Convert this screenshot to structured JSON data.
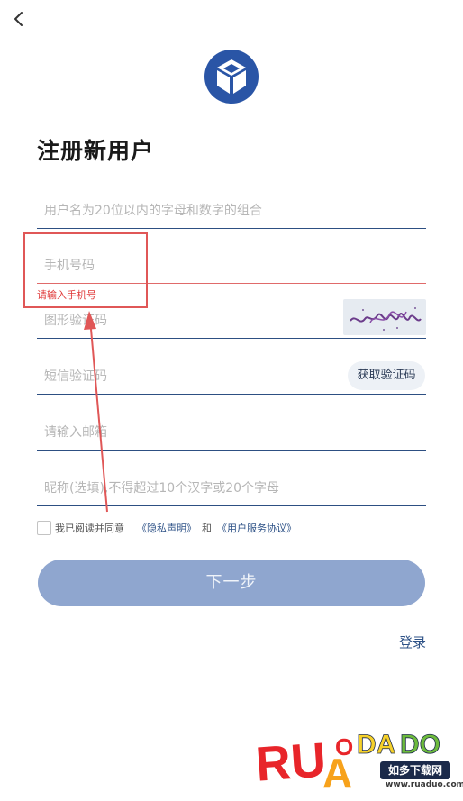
{
  "header": {
    "back_icon": "chevron-left-icon",
    "logo_icon": "cube-logo-icon"
  },
  "page": {
    "title": "注册新用户"
  },
  "form": {
    "username_placeholder": "用户名为20位以内的字母和数字的组合",
    "phone_placeholder": "手机号码",
    "phone_error": "请输入手机号",
    "captcha_placeholder": "图形验证码",
    "sms_placeholder": "短信验证码",
    "sms_button_label": "获取验证码",
    "email_placeholder": "请输入邮箱",
    "nickname_placeholder": "昵称(选填),不得超过10个汉字或20个字母"
  },
  "agreement": {
    "text": "我已阅读并同意",
    "privacy_link": "《隐私声明》",
    "and": "和",
    "service_link": "《用户服务协议》"
  },
  "actions": {
    "next_label": "下一步",
    "login_label": "登录"
  },
  "watermark": {
    "chinese": "如多下载网",
    "url": "www.ruaduo.com"
  },
  "colors": {
    "brand": "#2a55a6",
    "field_underline": "#2d4f82",
    "error": "#e03b3b",
    "annotation": "#e05757",
    "next_button": "#8fa6cf",
    "link": "#2e5287"
  }
}
